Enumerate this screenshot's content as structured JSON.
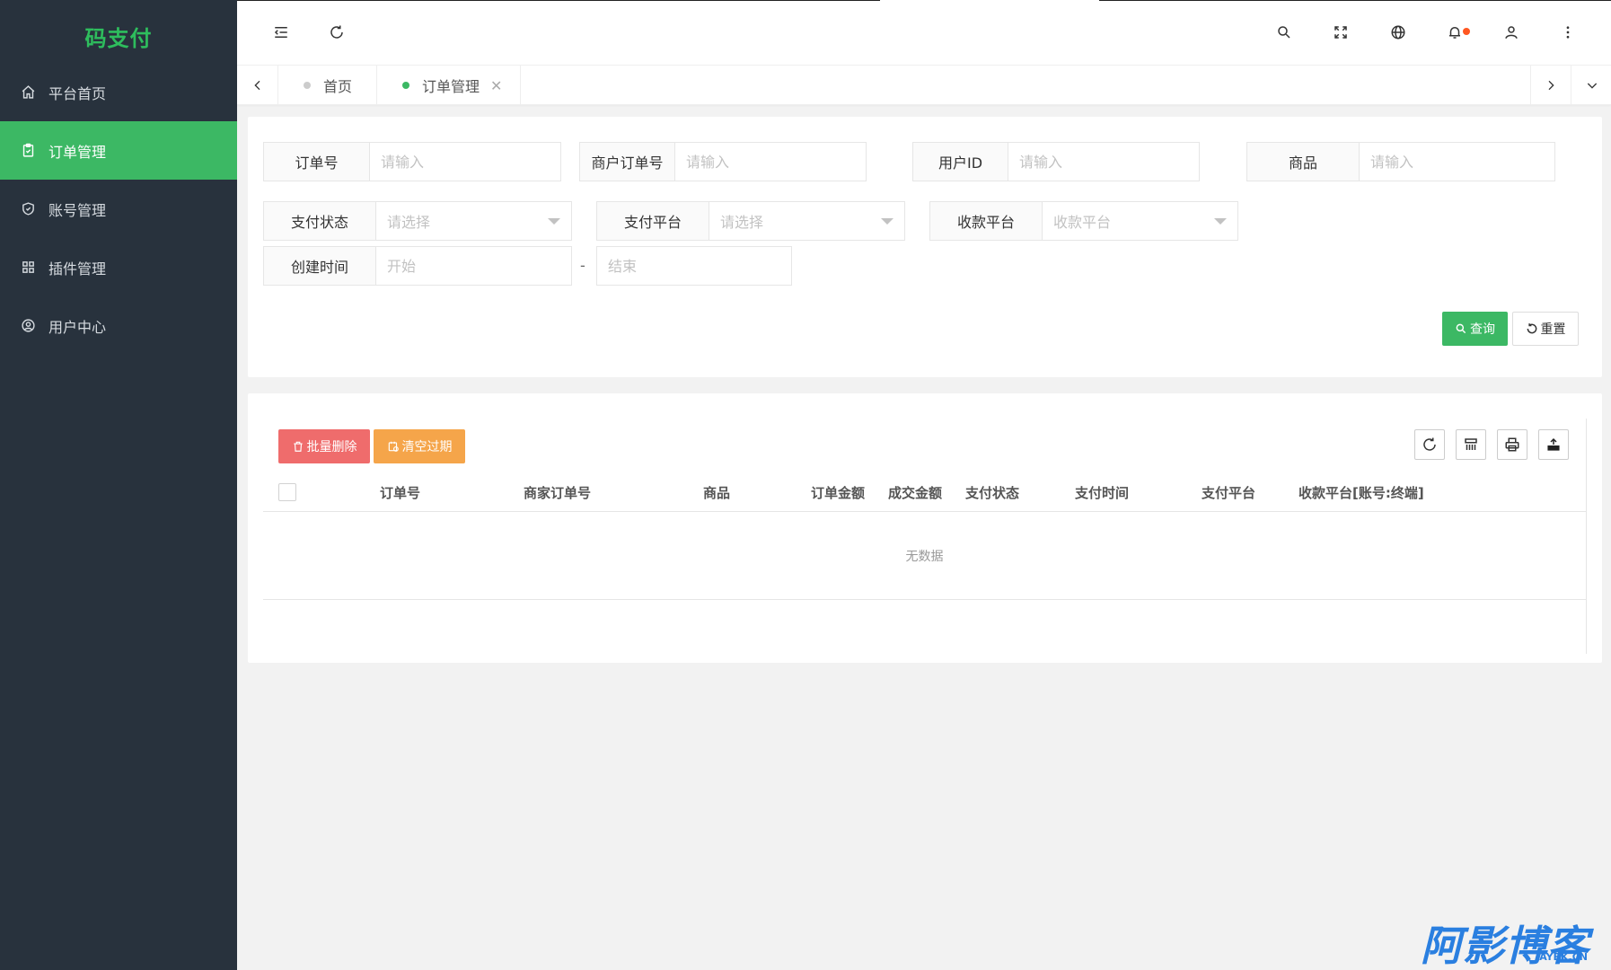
{
  "app": {
    "logo": "码支付"
  },
  "sidebar": {
    "items": [
      {
        "label": "平台首页",
        "icon": "home-icon",
        "active": false
      },
      {
        "label": "订单管理",
        "icon": "clipboard-check-icon",
        "active": true
      },
      {
        "label": "账号管理",
        "icon": "shield-check-icon",
        "active": false
      },
      {
        "label": "插件管理",
        "icon": "grid-icon",
        "active": false
      },
      {
        "label": "用户中心",
        "icon": "user-circle-icon",
        "active": false
      }
    ]
  },
  "header": {
    "left_icons": [
      "menu-fold-icon",
      "refresh-icon"
    ],
    "right_icons": [
      "search-icon",
      "fullscreen-icon",
      "globe-icon",
      "bell-icon",
      "user-icon",
      "more-vertical-icon"
    ],
    "notification_dot_color": "#ff5722"
  },
  "tabs": [
    {
      "label": "首页",
      "active": false
    },
    {
      "label": "订单管理",
      "active": true,
      "close": "✕"
    }
  ],
  "search": {
    "order_no": {
      "label": "订单号",
      "placeholder": "请输入"
    },
    "merchant_order_no": {
      "label": "商户订单号",
      "placeholder": "请输入"
    },
    "user_id": {
      "label": "用户ID",
      "placeholder": "请输入"
    },
    "product": {
      "label": "商品",
      "placeholder": "请输入"
    },
    "pay_status": {
      "label": "支付状态",
      "placeholder": "请选择"
    },
    "pay_platform": {
      "label": "支付平台",
      "placeholder": "请选择"
    },
    "receive_platform": {
      "label": "收款平台",
      "placeholder": "收款平台"
    },
    "create_time": {
      "label": "创建时间",
      "start_placeholder": "开始",
      "separator": "-",
      "end_placeholder": "结束"
    },
    "query_label": "查询",
    "reset_label": "重置"
  },
  "table": {
    "batch_delete_label": "批量删除",
    "clear_expired_label": "清空过期",
    "toolbar_icons": [
      "refresh-icon",
      "columns-icon",
      "print-icon",
      "export-icon"
    ],
    "columns": [
      "订单号",
      "商家订单号",
      "商品",
      "订单金额",
      "成交金额",
      "支付状态",
      "支付时间",
      "支付平台",
      "收款平台[账号:终端]"
    ],
    "empty_text": "无数据"
  },
  "watermark": {
    "text": "阿影博客",
    "sub": "AYBK.CN"
  },
  "colors": {
    "sidebar_bg": "#28323d",
    "accent_green": "#3cb864",
    "danger": "#ef6c6c",
    "warning": "#f5a54a"
  }
}
